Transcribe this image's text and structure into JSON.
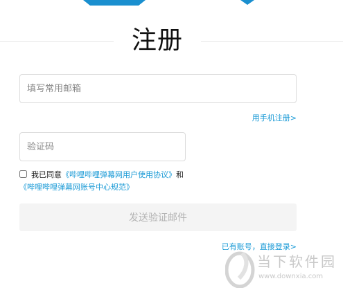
{
  "page": {
    "title": "注册"
  },
  "form": {
    "email_placeholder": "填写常用邮箱",
    "phone_register_link": "用手机注册>",
    "code_placeholder": "验证码",
    "agree_prefix": "我已同意",
    "agreement_link_1": "《哔哩哔哩弹幕网用户使用协议》",
    "agree_and": "和",
    "agreement_link_2": "《哔哩哔哩弹幕网账号中心规范》",
    "send_button_label": "发送验证邮件",
    "login_link": "已有账号，直接登录>"
  },
  "watermark": {
    "brand": "当下软件园",
    "url": "www.downxia.com"
  },
  "colors": {
    "accent": "#1a9ad6",
    "deco_blue": "#1a8fcf",
    "button_bg": "#f4f4f4",
    "button_text": "#b3b3b3"
  }
}
